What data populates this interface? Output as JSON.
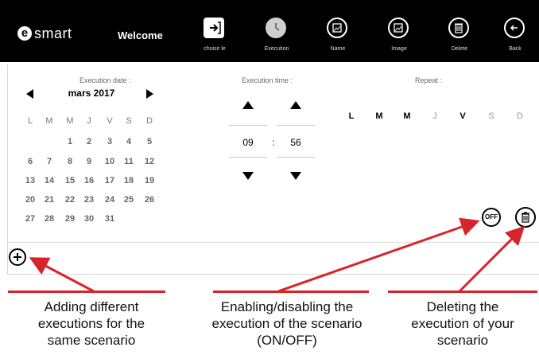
{
  "header": {
    "logo_letter": "e",
    "logo_text": "smart",
    "welcome": "Welcome",
    "tools": [
      {
        "name": "choose-file",
        "label": "choisir le",
        "icon": "file-import-icon"
      },
      {
        "name": "execution",
        "label": "Execution",
        "icon": "clock-icon"
      },
      {
        "name": "name",
        "label": "Name",
        "icon": "image-icon"
      },
      {
        "name": "image",
        "label": "Image",
        "icon": "image-icon"
      },
      {
        "name": "delete",
        "label": "Delete",
        "icon": "trash-icon"
      },
      {
        "name": "back",
        "label": "Back",
        "icon": "arrow-left-icon"
      }
    ]
  },
  "execution_date": {
    "title": "Execution date :",
    "month": "mars 2017",
    "weekday_headers": [
      "L",
      "M",
      "M",
      "J",
      "V",
      "S",
      "D"
    ],
    "weeks": [
      [
        "",
        "",
        "1",
        "2",
        "3",
        "4",
        "5"
      ],
      [
        "6",
        "7",
        "8",
        "9",
        "10",
        "11",
        "12"
      ],
      [
        "13",
        "14",
        "15",
        "16",
        "17",
        "18",
        "19"
      ],
      [
        "20",
        "21",
        "22",
        "23",
        "24",
        "25",
        "26"
      ],
      [
        "27",
        "28",
        "29",
        "30",
        "31",
        "",
        ""
      ]
    ]
  },
  "execution_time": {
    "title": "Execution time :",
    "hour": "09",
    "separator": ":",
    "minute": "56"
  },
  "repeat": {
    "title": "Repeat :",
    "days": [
      {
        "label": "L",
        "active": true
      },
      {
        "label": "M",
        "active": true
      },
      {
        "label": "M",
        "active": true
      },
      {
        "label": "J",
        "active": false
      },
      {
        "label": "V",
        "active": true
      },
      {
        "label": "S",
        "active": false
      },
      {
        "label": "D",
        "active": false
      }
    ]
  },
  "controls": {
    "off_label": "OFF"
  },
  "annotations": {
    "add": [
      "Adding different",
      "executions for the",
      "same scenario"
    ],
    "toggle": [
      "Enabling/disabling the",
      "execution of the scenario",
      "(ON/OFF)"
    ],
    "delete": [
      "Deleting the",
      "execution of your",
      "scenario"
    ]
  },
  "colors": {
    "topbar": "#000000",
    "annotation_red": "#d8232a"
  }
}
